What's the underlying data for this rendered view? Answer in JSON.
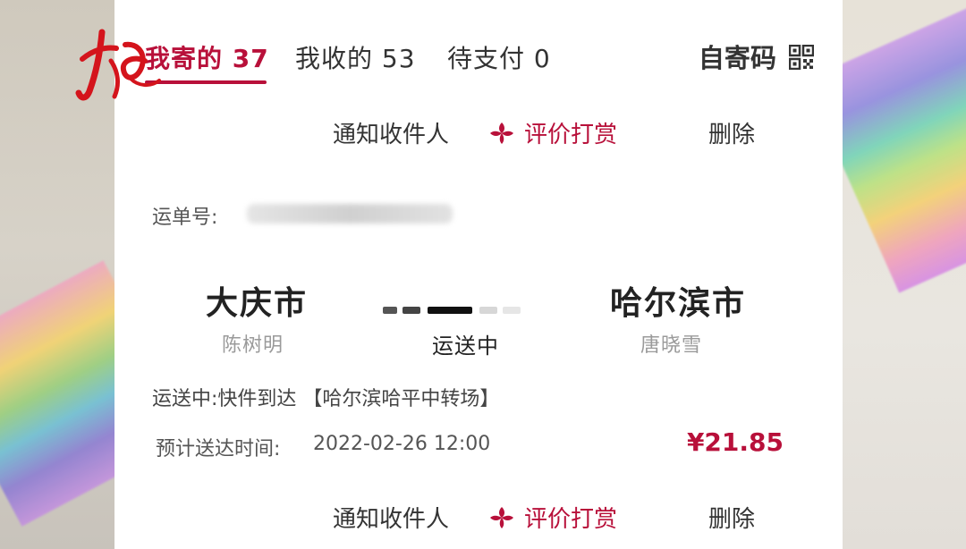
{
  "tabs": [
    {
      "label": "我寄的 37"
    },
    {
      "label": "我收的 53"
    },
    {
      "label": "待支付 0"
    }
  ],
  "self_send_code": "自寄码",
  "actions": {
    "notify": "通知收件人",
    "rate": "评价打赏",
    "delete": "删除"
  },
  "shipment": {
    "waybill_label": "运单号:",
    "origin_city": "大庆市",
    "origin_person": "陈树明",
    "status": "运送中",
    "dest_city": "哈尔滨市",
    "dest_person": "唐晓雪",
    "tracking": "运送中:快件到达 【哈尔滨哈平中转场】",
    "eta_label": "预计送达时间:",
    "eta_value": "2022-02-26 12:00",
    "price": "¥21.85"
  },
  "colors": {
    "accent": "#b8103a"
  }
}
